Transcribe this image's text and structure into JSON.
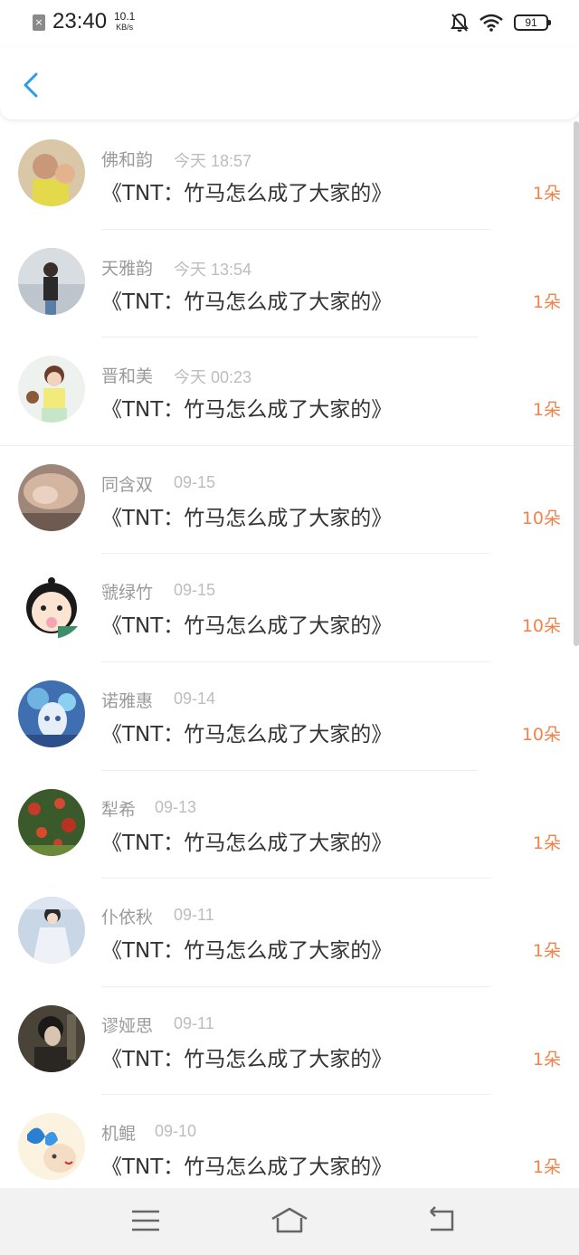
{
  "status_bar": {
    "time": "23:40",
    "speed_value": "10.1",
    "speed_unit": "KB/s",
    "battery": "91"
  },
  "colors": {
    "accent": "#2f9be6",
    "flowers": "#f0834a",
    "name": "#9a9a9a",
    "date": "#bdbdbd"
  },
  "list": {
    "items": [
      {
        "name": "佛和韵",
        "date": "今天 18:57",
        "title": "《TNT：竹马怎么成了大家的》",
        "flowers": "1朵"
      },
      {
        "name": "天雅韵",
        "date": "今天 13:54",
        "title": "《TNT：竹马怎么成了大家的》",
        "flowers": "1朵"
      },
      {
        "name": "晋和美",
        "date": "今天 00:23",
        "title": "《TNT：竹马怎么成了大家的》",
        "flowers": "1朵"
      },
      {
        "name": "同含双",
        "date": "09-15",
        "title": "《TNT：竹马怎么成了大家的》",
        "flowers": "10朵"
      },
      {
        "name": "虢绿竹",
        "date": "09-15",
        "title": "《TNT：竹马怎么成了大家的》",
        "flowers": "10朵"
      },
      {
        "name": "诺雅惠",
        "date": "09-14",
        "title": "《TNT：竹马怎么成了大家的》",
        "flowers": "10朵"
      },
      {
        "name": "犁希",
        "date": "09-13",
        "title": "《TNT：竹马怎么成了大家的》",
        "flowers": "1朵"
      },
      {
        "name": "仆依秋",
        "date": "09-11",
        "title": "《TNT：竹马怎么成了大家的》",
        "flowers": "1朵"
      },
      {
        "name": "谬娅思",
        "date": "09-11",
        "title": "《TNT：竹马怎么成了大家的》",
        "flowers": "1朵"
      },
      {
        "name": "机鲲",
        "date": "09-10",
        "title": "《TNT：竹马怎么成了大家的》",
        "flowers": "1朵"
      }
    ]
  }
}
